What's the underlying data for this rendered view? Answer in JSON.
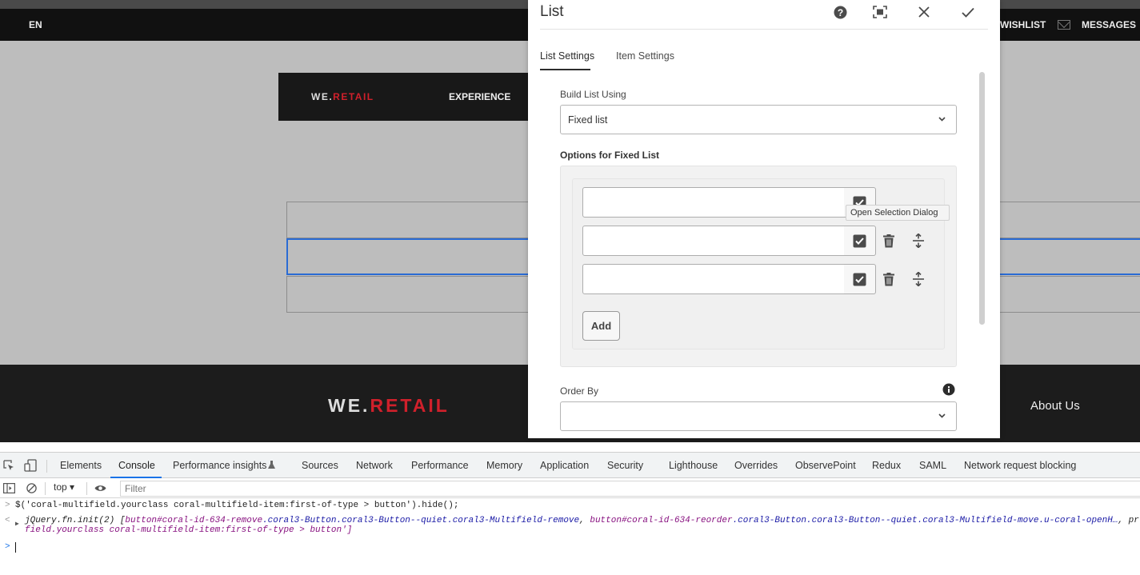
{
  "site": {
    "lang": "EN",
    "wishlist": "WISHLIST",
    "messages": "MESSAGES",
    "brand_we": "WE.",
    "brand_retail": "RETAIL",
    "nav_experience": "EXPERIENCE",
    "footer_brand_we": "WE.",
    "footer_brand_retail": "RETAIL",
    "about_us": "About Us"
  },
  "dialog": {
    "title": "List",
    "tabs": [
      "List Settings",
      "Item Settings"
    ],
    "build_list_label": "Build List Using",
    "build_list_value": "Fixed list",
    "options_heading": "Options for Fixed List",
    "add_label": "Add",
    "tooltip": "Open Selection Dialog",
    "order_by_label": "Order By",
    "order_by_value": ""
  },
  "devtools": {
    "tabs": [
      "Elements",
      "Console",
      "Performance insights",
      "Sources",
      "Network",
      "Performance",
      "Memory",
      "Application",
      "Security",
      "Lighthouse",
      "Overrides",
      "ObservePoint",
      "Redux",
      "SAML",
      "Network request blocking"
    ],
    "active_tab": "Console",
    "context": "top",
    "filter_placeholder": "Filter",
    "input_line": "$('coral-multifield.yourclass coral-multifield-item:first-of-type > button').hide();",
    "output_prefix": "jQuery.fn.init(2) [",
    "output_sel1": "button#coral-id-634-remove",
    "output_cls1": ".coral3-Button.coral3-Button--quiet.coral3-Multifield-remove",
    "output_sep": ", ",
    "output_sel2": "button#coral-id-634-reorder",
    "output_cls2": ".coral3-Button.coral3-Button--quiet.coral3-Multifield-move.u-coral-openH…",
    "output_tail": ", pr",
    "output_line2": "field.yourclass coral-multifield-item:first-of-type > button']"
  },
  "colors": {
    "brand_red": "#d0202b",
    "focus_blue": "#2a6bd4",
    "devtools_blue": "#1a73e8"
  }
}
